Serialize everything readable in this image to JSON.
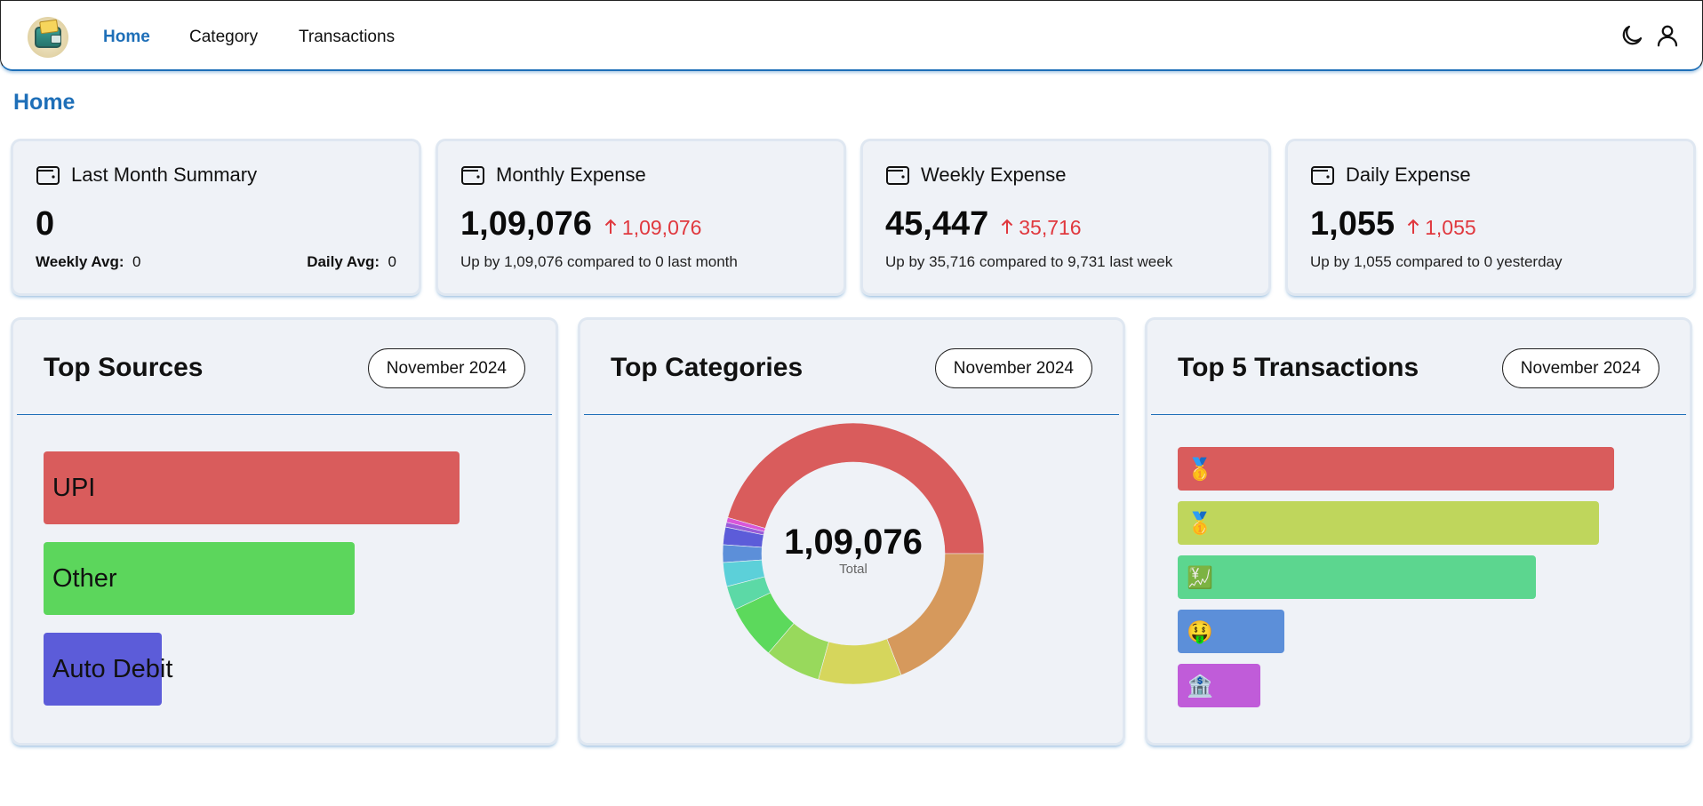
{
  "nav": {
    "links": [
      "Home",
      "Category",
      "Transactions"
    ],
    "active": "Home",
    "icons": [
      "theme-toggle-moon-icon",
      "user-profile-icon"
    ]
  },
  "page": {
    "title": "Home"
  },
  "stats": [
    {
      "label": "Last Month Summary",
      "value": "0",
      "weekly_avg_label": "Weekly Avg:",
      "weekly_avg_value": "0",
      "daily_avg_label": "Daily Avg:",
      "daily_avg_value": "0"
    },
    {
      "label": "Monthly Expense",
      "value": "1,09,076",
      "delta": "1,09,076",
      "subtitle": "Up by 1,09,076 compared to 0 last month"
    },
    {
      "label": "Weekly Expense",
      "value": "45,447",
      "delta": "35,716",
      "subtitle": "Up by 35,716 compared to 9,731 last week"
    },
    {
      "label": "Daily Expense",
      "value": "1,055",
      "delta": "1,055",
      "subtitle": "Up by 1,055 compared to 0 yesterday"
    }
  ],
  "colors": {
    "accent": "#1e6fb8",
    "delta_up": "#e0383e",
    "card_bg": "#eff2f7"
  },
  "top_sources": {
    "title": "Top Sources",
    "month": "November 2024",
    "items": [
      {
        "label": "UPI",
        "share": 1.0,
        "color": "#d95c5c"
      },
      {
        "label": "Other",
        "share": 0.747,
        "color": "#5cd65c"
      },
      {
        "label": "Auto Debit",
        "share": 0.285,
        "color": "#5c5cd9"
      }
    ]
  },
  "top_categories": {
    "title": "Top Categories",
    "month": "November 2024",
    "total_value": "1,09,076",
    "total_label": "Total",
    "segments": [
      {
        "value": 46.0,
        "color": "#d95c5c"
      },
      {
        "value": 0.6,
        "color": "#d957d9"
      },
      {
        "value": 0.6,
        "color": "#9a5cd9"
      },
      {
        "value": 2.2,
        "color": "#5c5cd9"
      },
      {
        "value": 2.2,
        "color": "#5c8fd9"
      },
      {
        "value": 3.0,
        "color": "#5cd0d9"
      },
      {
        "value": 3.0,
        "color": "#5cd9a6"
      },
      {
        "value": 6.8,
        "color": "#5cd95c"
      },
      {
        "value": 7.0,
        "color": "#98d95c"
      },
      {
        "value": 10.4,
        "color": "#d6d65c"
      },
      {
        "value": 19.2,
        "color": "#d6995c"
      }
    ]
  },
  "top_transactions": {
    "title": "Top 5 Transactions",
    "month": "November 2024",
    "items": [
      {
        "emoji": "🥇",
        "share": 1.0,
        "color": "#d95c5c"
      },
      {
        "emoji": "🥇",
        "share": 0.965,
        "color": "#bfd65c"
      },
      {
        "emoji": "💹",
        "share": 0.82,
        "color": "#5cd68f"
      },
      {
        "emoji": "🤑",
        "share": 0.245,
        "color": "#5c8fd9"
      },
      {
        "emoji": "🏦",
        "share": 0.19,
        "color": "#c05cd9"
      }
    ]
  }
}
